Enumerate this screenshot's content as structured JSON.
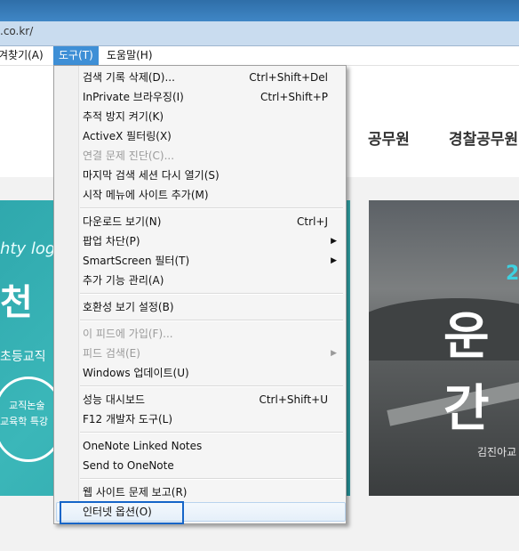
{
  "address": {
    "url_text": ".co.kr/"
  },
  "menubar": {
    "favorites": "겨찾기(A)",
    "tools": "도구(T)",
    "help": "도움말(H)"
  },
  "page": {
    "nav_1": "공무원",
    "nav_2": "경찰공무원",
    "teal_small": "hty log",
    "teal_big": "천 초",
    "teal_sub": "초등교직",
    "teal_circle_1": "교직논술",
    "teal_circle_2": "교육학 특강",
    "road_accent": "2",
    "road_big": "운간",
    "road_sub": "김진아교"
  },
  "tools_menu": {
    "groups": [
      [
        {
          "label": "검색 기록 삭제(D)...",
          "shortcut": "Ctrl+Shift+Del",
          "enabled": true
        },
        {
          "label": "InPrivate 브라우징(I)",
          "shortcut": "Ctrl+Shift+P",
          "enabled": true
        },
        {
          "label": "추적 방지 켜기(K)",
          "shortcut": "",
          "enabled": true
        },
        {
          "label": "ActiveX 필터링(X)",
          "shortcut": "",
          "enabled": true
        },
        {
          "label": "연결 문제 진단(C)...",
          "shortcut": "",
          "enabled": false
        },
        {
          "label": "마지막 검색 세션 다시 열기(S)",
          "shortcut": "",
          "enabled": true
        },
        {
          "label": "시작 메뉴에 사이트 추가(M)",
          "shortcut": "",
          "enabled": true
        }
      ],
      [
        {
          "label": "다운로드 보기(N)",
          "shortcut": "Ctrl+J",
          "enabled": true
        },
        {
          "label": "팝업 차단(P)",
          "shortcut": "",
          "enabled": true,
          "submenu": true
        },
        {
          "label": "SmartScreen 필터(T)",
          "shortcut": "",
          "enabled": true,
          "submenu": true
        },
        {
          "label": "추가 기능 관리(A)",
          "shortcut": "",
          "enabled": true
        }
      ],
      [
        {
          "label": "호환성 보기 설정(B)",
          "shortcut": "",
          "enabled": true
        }
      ],
      [
        {
          "label": "이 피드에 가입(F)...",
          "shortcut": "",
          "enabled": false
        },
        {
          "label": "피드 검색(E)",
          "shortcut": "",
          "enabled": false,
          "submenu": true
        },
        {
          "label": "Windows 업데이트(U)",
          "shortcut": "",
          "enabled": true
        }
      ],
      [
        {
          "label": "성능 대시보드",
          "shortcut": "Ctrl+Shift+U",
          "enabled": true
        },
        {
          "label": "F12 개발자 도구(L)",
          "shortcut": "",
          "enabled": true
        }
      ],
      [
        {
          "label": "OneNote Linked Notes",
          "shortcut": "",
          "enabled": true
        },
        {
          "label": "Send to OneNote",
          "shortcut": "",
          "enabled": true
        }
      ],
      [
        {
          "label": "웹 사이트 문제 보고(R)",
          "shortcut": "",
          "enabled": true
        },
        {
          "label": "인터넷 옵션(O)",
          "shortcut": "",
          "enabled": true,
          "highlighted": true
        }
      ]
    ]
  },
  "colors": {
    "menu_active": "#3e8fd6",
    "focus_border": "#1565c8",
    "teal": "#35b0b4",
    "accent_cyan": "#3ed1e0"
  }
}
